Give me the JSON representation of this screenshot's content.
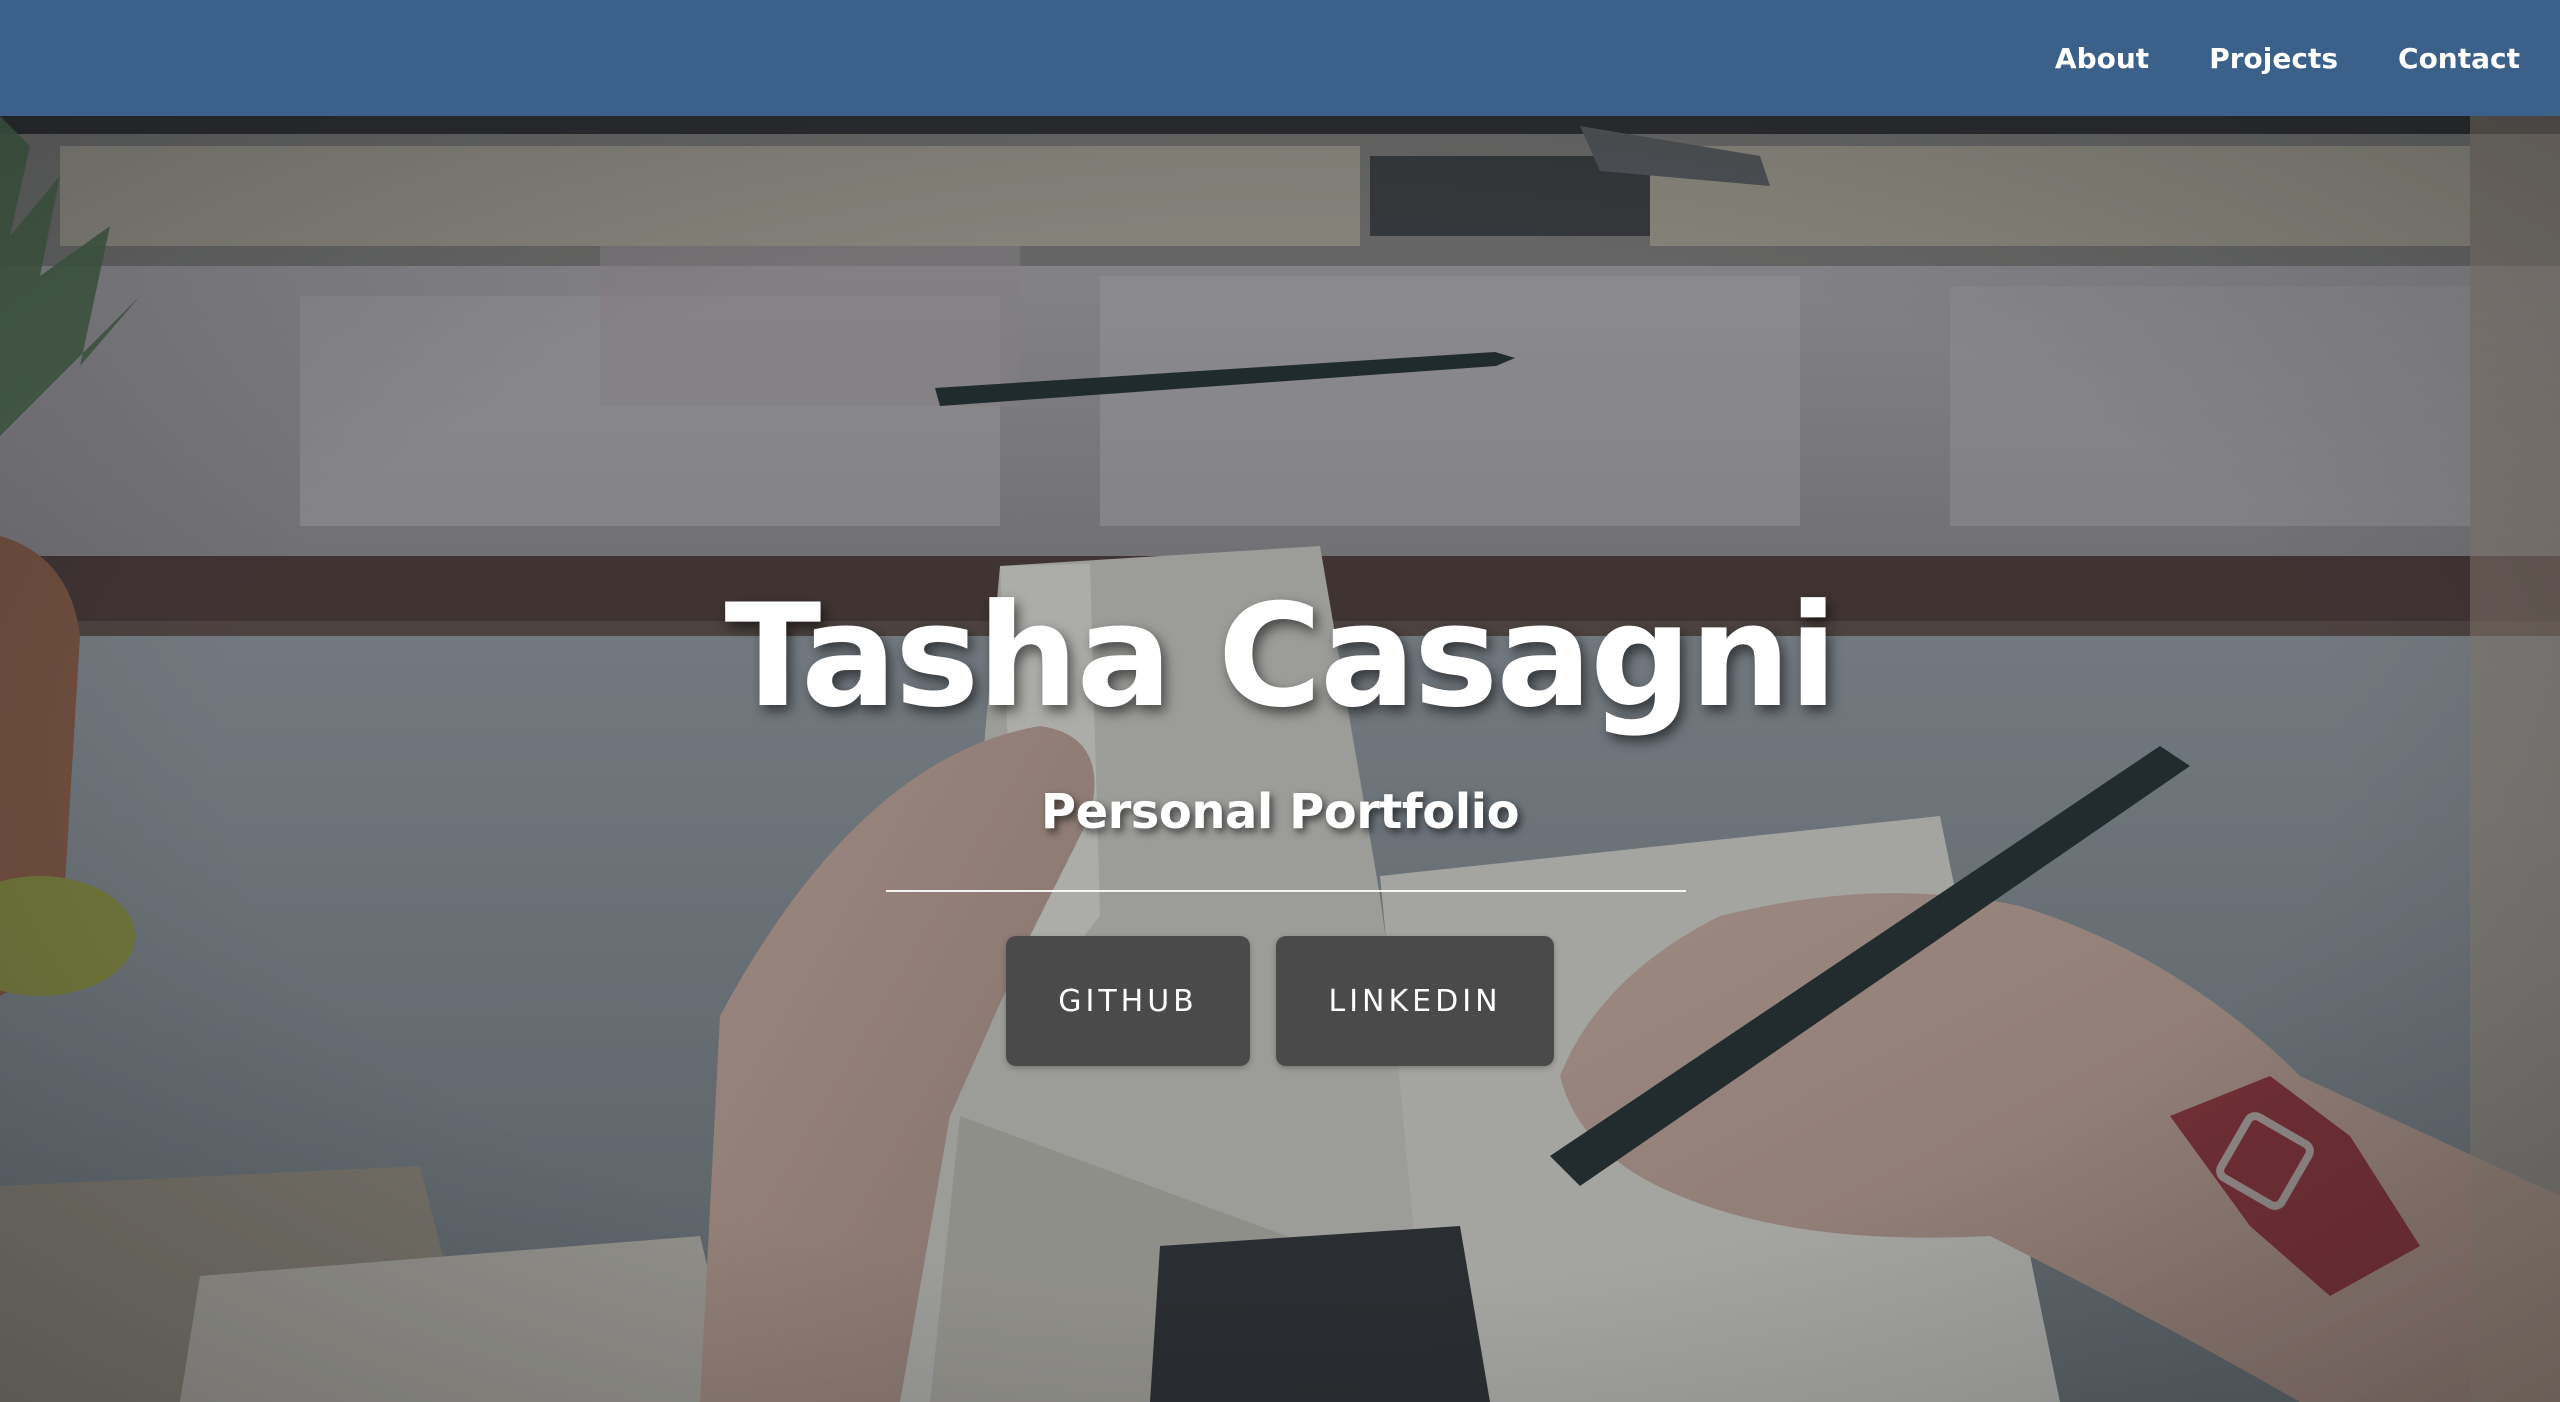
{
  "nav": {
    "links": [
      "About",
      "Projects",
      "Contact"
    ]
  },
  "hero": {
    "title": "Tasha Casagni",
    "subtitle": "Personal Portfolio",
    "buttons": [
      "GITHUB",
      "LINKEDIN"
    ]
  },
  "colors": {
    "navbar": "#3b6089",
    "button": "#4a4a4a",
    "text": "#ffffff"
  },
  "background": {
    "description_icon": "desk-writing-photo"
  }
}
